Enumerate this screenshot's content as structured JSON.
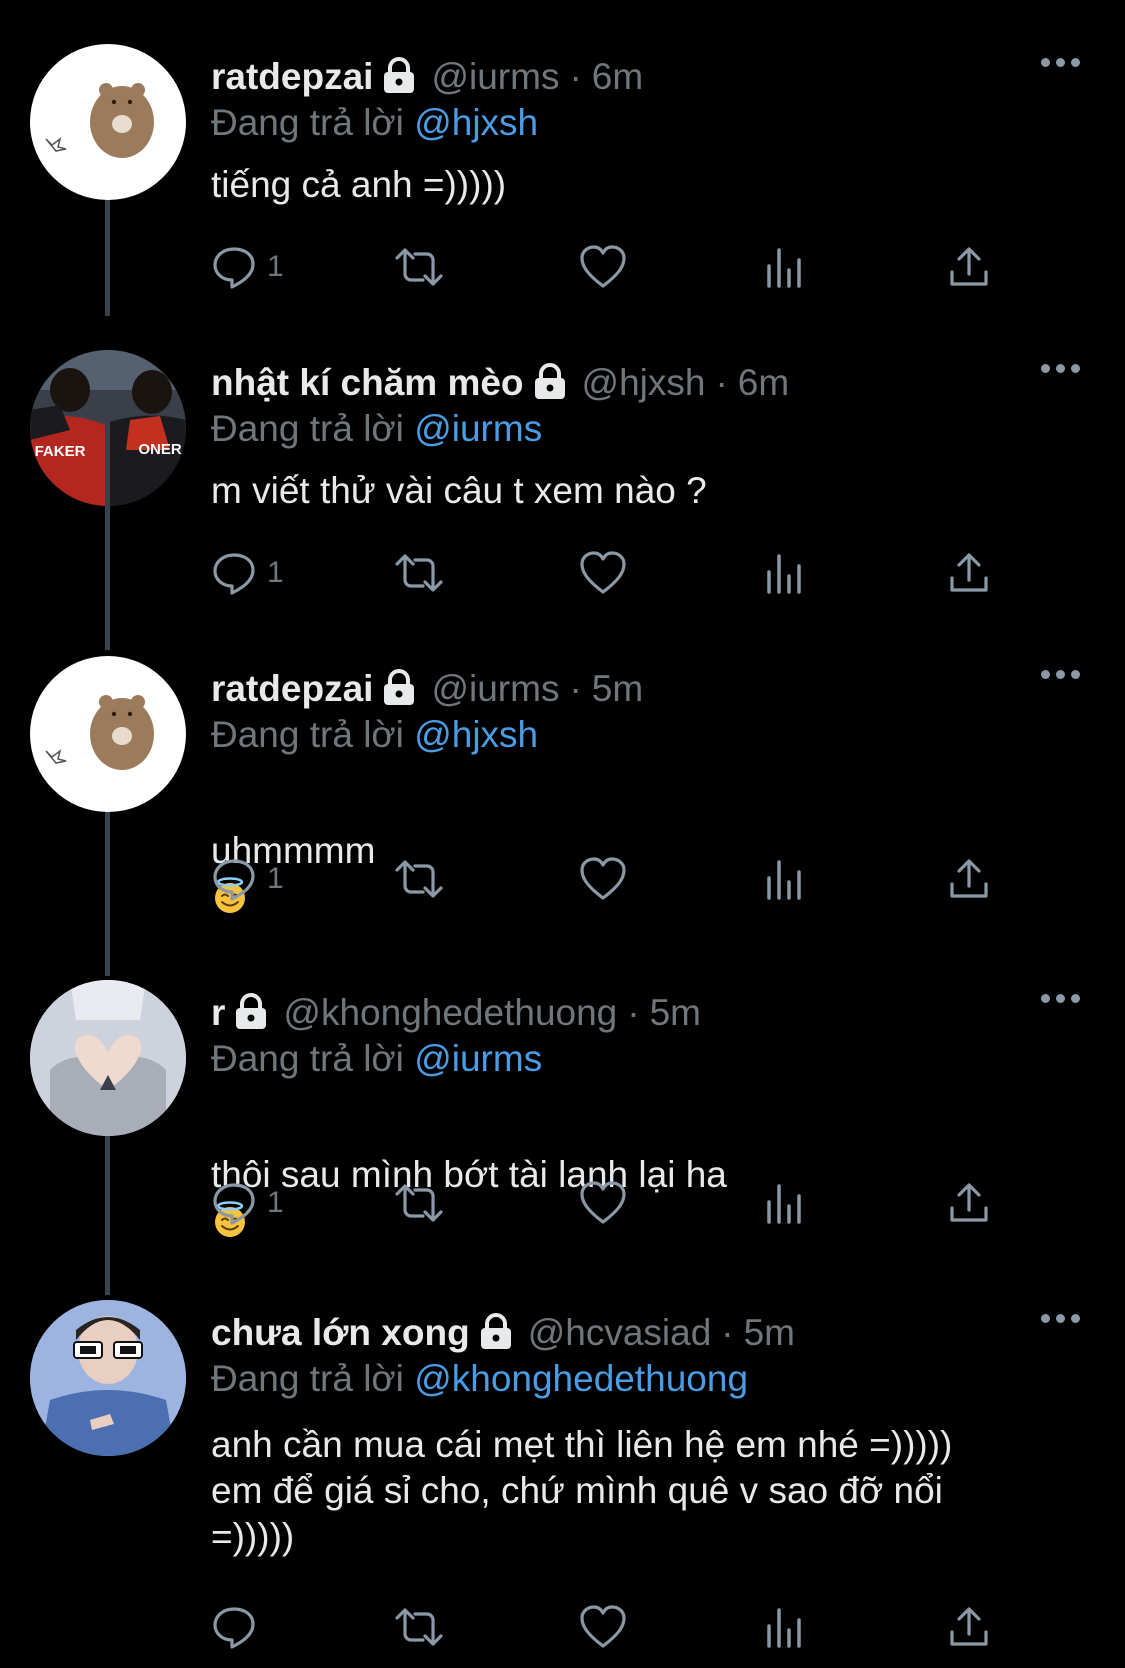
{
  "tweets": [
    {
      "name": "ratdepzai",
      "handle": "@iurms",
      "time": "6m",
      "reply_prefix": "Đang trả lời",
      "reply_to": "@hjxsh",
      "text": "tiếng cả anh =)))))",
      "reply_count": "1",
      "avatar": "bear-avatar"
    },
    {
      "name": "nhật kí chăm mèo",
      "handle": "@hjxsh",
      "time": "6m",
      "reply_prefix": "Đang trả lời",
      "reply_to": "@iurms",
      "text": "m viết thử vài câu t xem nào ?",
      "reply_count": "1",
      "avatar": "esports-avatar",
      "avatar_labels": [
        "FAKER",
        "ONER"
      ]
    },
    {
      "name": "ratdepzai",
      "handle": "@iurms",
      "time": "5m",
      "reply_prefix": "Đang trả lời",
      "reply_to": "@hjxsh",
      "text": "uhmmmm",
      "reply_count": "1",
      "avatar": "bear-avatar"
    },
    {
      "name": "r",
      "handle": "@khonghedethuong",
      "time": "5m",
      "reply_prefix": "Đang trả lời",
      "reply_to": "@iurms",
      "text": "thôi sau mình bớt tài lanh lại ha",
      "reply_count": "1",
      "avatar": "heart-hands-avatar"
    },
    {
      "name": "chưa lớn xong",
      "handle": "@hcvasiad",
      "time": "5m",
      "reply_prefix": "Đang trả lời",
      "reply_to": "@khonghedethuong",
      "text": "anh cần mua cái mẹt thì liên hệ em nhé =)))))\nem để giá sỉ cho, chứ mình quê v sao đỡ nổi\n=)))))",
      "reply_count": "",
      "avatar": "sunglasses-avatar"
    }
  ],
  "separator": "·",
  "colors": {
    "background": "#000000",
    "text": "#e7e9ea",
    "muted": "#71767b",
    "mention": "#4a9de5",
    "thread_line": "#38444d"
  }
}
